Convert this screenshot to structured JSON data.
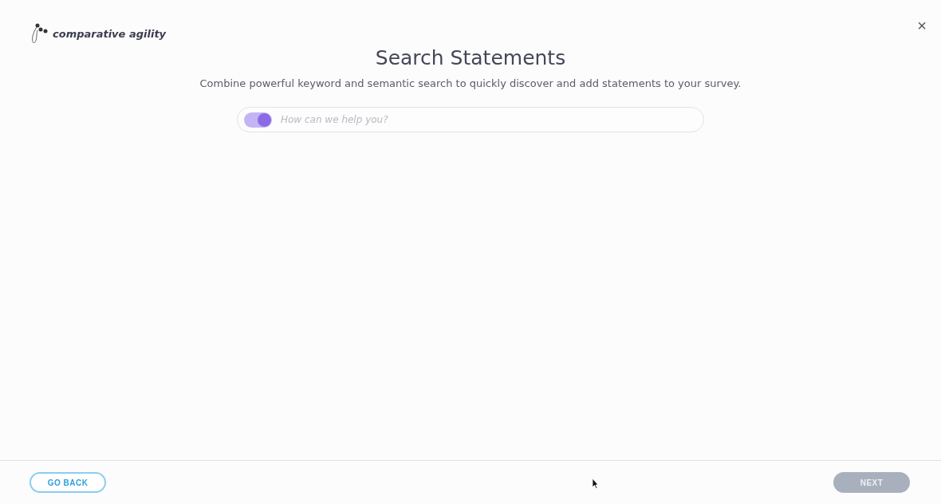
{
  "logo": {
    "text": "comparative agility"
  },
  "close": {
    "label": "×"
  },
  "title": "Search Statements",
  "subtitle": "Combine powerful keyword and semantic search to quickly discover and add statements to your survey.",
  "search": {
    "toggle_on": true,
    "placeholder": "How can we help you?"
  },
  "footer": {
    "back": {
      "label": "GO BACK",
      "disabled": false
    },
    "next": {
      "label": "NEXT",
      "disabled": true
    }
  }
}
